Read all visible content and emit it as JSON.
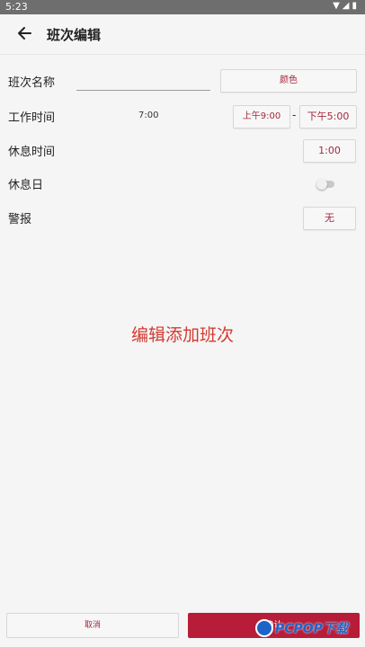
{
  "status_bar": {
    "time": "5:23",
    "icons": [
      "wifi-icon",
      "signal-icon",
      "battery-icon"
    ]
  },
  "toolbar": {
    "back_icon": "arrow-left-icon",
    "title": "班次编辑"
  },
  "form": {
    "shift_name": {
      "label": "班次名称",
      "value": "",
      "color_button": "颜色"
    },
    "work_time": {
      "label": "工作时间",
      "duration": "7:00",
      "start": "上午9:00",
      "separator": "-",
      "end": "下午5:00"
    },
    "break_time": {
      "label": "休息时间",
      "value": "1:00"
    },
    "rest_day": {
      "label": "休息日",
      "enabled": false
    },
    "alarm": {
      "label": "警报",
      "value": "无"
    }
  },
  "overlay_caption": "编辑添加班次",
  "footer": {
    "cancel": "取消",
    "confirm": "确认"
  },
  "watermark": {
    "text": "PCPOP下载"
  },
  "colors": {
    "accent": "#b71c38",
    "button_text": "#a3293e",
    "caption": "#d33a31",
    "background": "#f5f5f5"
  }
}
